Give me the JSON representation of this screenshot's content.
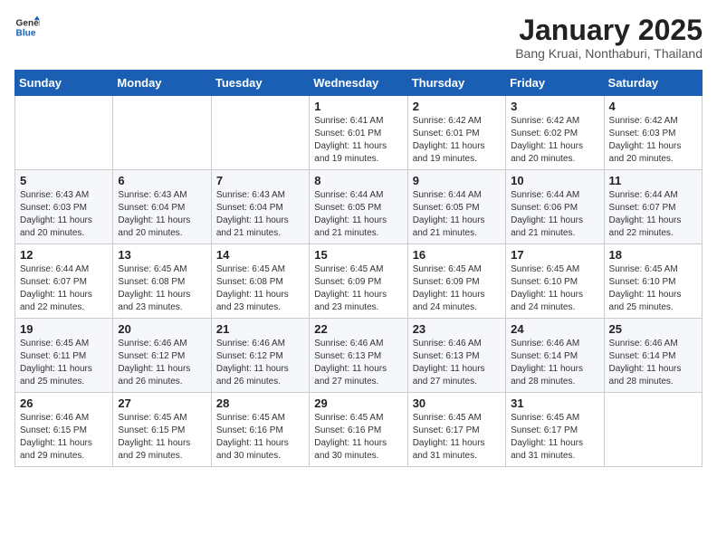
{
  "logo": {
    "general": "General",
    "blue": "Blue"
  },
  "title": "January 2025",
  "location": "Bang Kruai, Nonthaburi, Thailand",
  "days_of_week": [
    "Sunday",
    "Monday",
    "Tuesday",
    "Wednesday",
    "Thursday",
    "Friday",
    "Saturday"
  ],
  "weeks": [
    [
      {
        "day": "",
        "info": ""
      },
      {
        "day": "",
        "info": ""
      },
      {
        "day": "",
        "info": ""
      },
      {
        "day": "1",
        "info": "Sunrise: 6:41 AM\nSunset: 6:01 PM\nDaylight: 11 hours and 19 minutes."
      },
      {
        "day": "2",
        "info": "Sunrise: 6:42 AM\nSunset: 6:01 PM\nDaylight: 11 hours and 19 minutes."
      },
      {
        "day": "3",
        "info": "Sunrise: 6:42 AM\nSunset: 6:02 PM\nDaylight: 11 hours and 20 minutes."
      },
      {
        "day": "4",
        "info": "Sunrise: 6:42 AM\nSunset: 6:03 PM\nDaylight: 11 hours and 20 minutes."
      }
    ],
    [
      {
        "day": "5",
        "info": "Sunrise: 6:43 AM\nSunset: 6:03 PM\nDaylight: 11 hours and 20 minutes."
      },
      {
        "day": "6",
        "info": "Sunrise: 6:43 AM\nSunset: 6:04 PM\nDaylight: 11 hours and 20 minutes."
      },
      {
        "day": "7",
        "info": "Sunrise: 6:43 AM\nSunset: 6:04 PM\nDaylight: 11 hours and 21 minutes."
      },
      {
        "day": "8",
        "info": "Sunrise: 6:44 AM\nSunset: 6:05 PM\nDaylight: 11 hours and 21 minutes."
      },
      {
        "day": "9",
        "info": "Sunrise: 6:44 AM\nSunset: 6:05 PM\nDaylight: 11 hours and 21 minutes."
      },
      {
        "day": "10",
        "info": "Sunrise: 6:44 AM\nSunset: 6:06 PM\nDaylight: 11 hours and 21 minutes."
      },
      {
        "day": "11",
        "info": "Sunrise: 6:44 AM\nSunset: 6:07 PM\nDaylight: 11 hours and 22 minutes."
      }
    ],
    [
      {
        "day": "12",
        "info": "Sunrise: 6:44 AM\nSunset: 6:07 PM\nDaylight: 11 hours and 22 minutes."
      },
      {
        "day": "13",
        "info": "Sunrise: 6:45 AM\nSunset: 6:08 PM\nDaylight: 11 hours and 23 minutes."
      },
      {
        "day": "14",
        "info": "Sunrise: 6:45 AM\nSunset: 6:08 PM\nDaylight: 11 hours and 23 minutes."
      },
      {
        "day": "15",
        "info": "Sunrise: 6:45 AM\nSunset: 6:09 PM\nDaylight: 11 hours and 23 minutes."
      },
      {
        "day": "16",
        "info": "Sunrise: 6:45 AM\nSunset: 6:09 PM\nDaylight: 11 hours and 24 minutes."
      },
      {
        "day": "17",
        "info": "Sunrise: 6:45 AM\nSunset: 6:10 PM\nDaylight: 11 hours and 24 minutes."
      },
      {
        "day": "18",
        "info": "Sunrise: 6:45 AM\nSunset: 6:10 PM\nDaylight: 11 hours and 25 minutes."
      }
    ],
    [
      {
        "day": "19",
        "info": "Sunrise: 6:45 AM\nSunset: 6:11 PM\nDaylight: 11 hours and 25 minutes."
      },
      {
        "day": "20",
        "info": "Sunrise: 6:46 AM\nSunset: 6:12 PM\nDaylight: 11 hours and 26 minutes."
      },
      {
        "day": "21",
        "info": "Sunrise: 6:46 AM\nSunset: 6:12 PM\nDaylight: 11 hours and 26 minutes."
      },
      {
        "day": "22",
        "info": "Sunrise: 6:46 AM\nSunset: 6:13 PM\nDaylight: 11 hours and 27 minutes."
      },
      {
        "day": "23",
        "info": "Sunrise: 6:46 AM\nSunset: 6:13 PM\nDaylight: 11 hours and 27 minutes."
      },
      {
        "day": "24",
        "info": "Sunrise: 6:46 AM\nSunset: 6:14 PM\nDaylight: 11 hours and 28 minutes."
      },
      {
        "day": "25",
        "info": "Sunrise: 6:46 AM\nSunset: 6:14 PM\nDaylight: 11 hours and 28 minutes."
      }
    ],
    [
      {
        "day": "26",
        "info": "Sunrise: 6:46 AM\nSunset: 6:15 PM\nDaylight: 11 hours and 29 minutes."
      },
      {
        "day": "27",
        "info": "Sunrise: 6:45 AM\nSunset: 6:15 PM\nDaylight: 11 hours and 29 minutes."
      },
      {
        "day": "28",
        "info": "Sunrise: 6:45 AM\nSunset: 6:16 PM\nDaylight: 11 hours and 30 minutes."
      },
      {
        "day": "29",
        "info": "Sunrise: 6:45 AM\nSunset: 6:16 PM\nDaylight: 11 hours and 30 minutes."
      },
      {
        "day": "30",
        "info": "Sunrise: 6:45 AM\nSunset: 6:17 PM\nDaylight: 11 hours and 31 minutes."
      },
      {
        "day": "31",
        "info": "Sunrise: 6:45 AM\nSunset: 6:17 PM\nDaylight: 11 hours and 31 minutes."
      },
      {
        "day": "",
        "info": ""
      }
    ]
  ]
}
